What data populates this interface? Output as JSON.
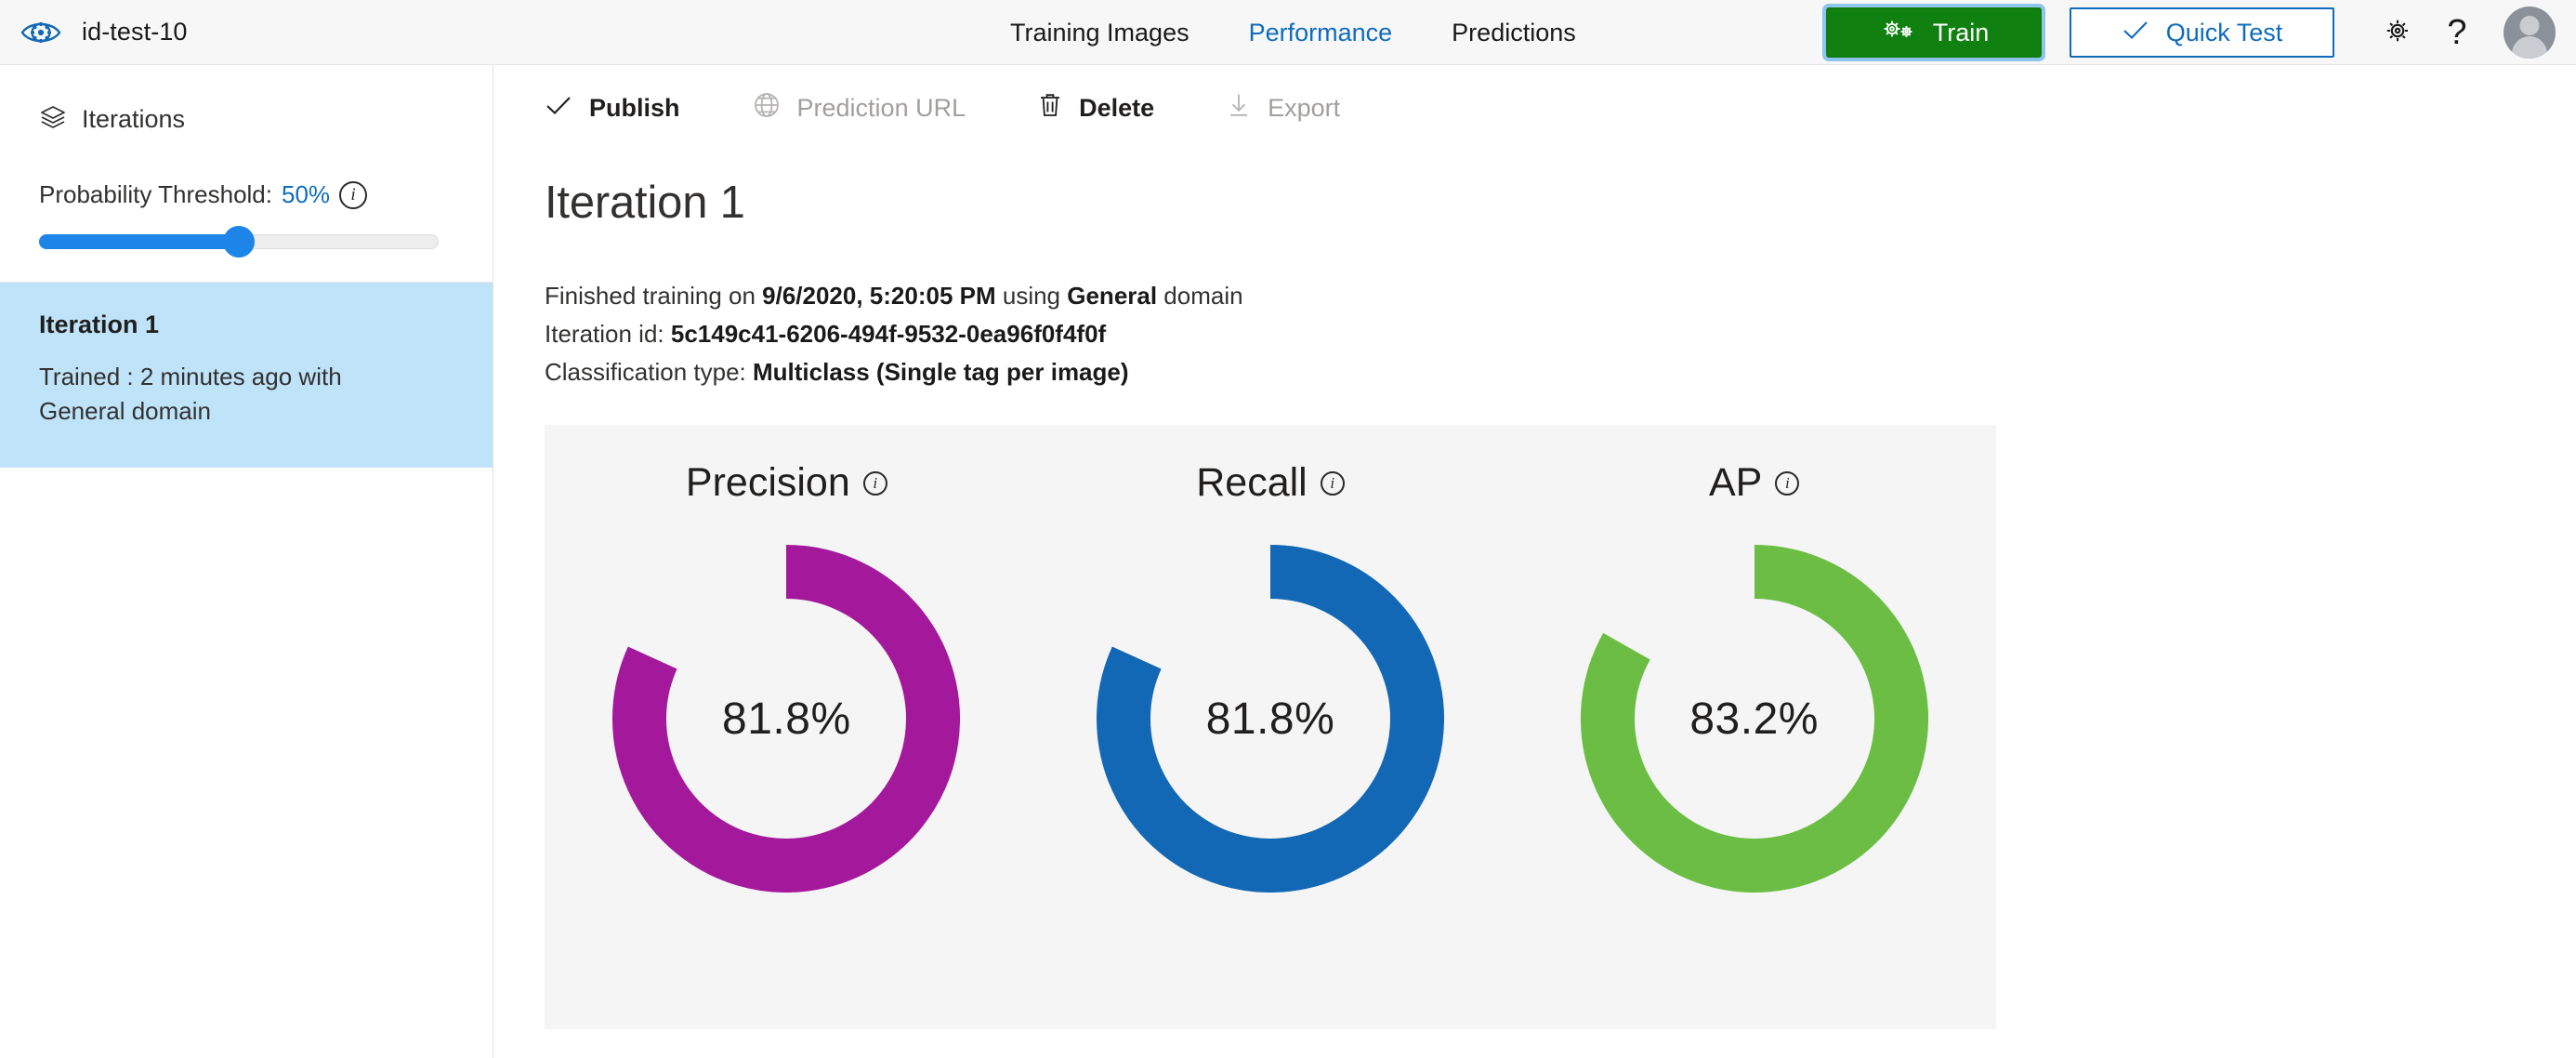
{
  "app": {
    "logo_icon": "eye-gear-logo-icon",
    "project_name": "id-test-10"
  },
  "nav": {
    "tabs": [
      {
        "label": "Training Images",
        "active": false
      },
      {
        "label": "Performance",
        "active": true
      },
      {
        "label": "Predictions",
        "active": false
      }
    ]
  },
  "topbar_actions": {
    "train_label": "Train",
    "train_icon": "gears-icon",
    "train_color": "#108010",
    "quick_test_label": "Quick Test",
    "quick_test_icon": "checkmark-icon",
    "quick_test_color": "#0f6cbd",
    "settings_icon": "gear-icon",
    "help_icon": "question-mark-icon",
    "help_glyph": "?",
    "avatar_icon": "user-avatar-icon"
  },
  "sidebar": {
    "header_label": "Iterations",
    "header_icon": "layers-icon",
    "threshold": {
      "label_prefix": "Probability Threshold:",
      "value": "50%",
      "percent": 50,
      "info_icon": "info-icon",
      "fill_color": "#1e85e8"
    },
    "iterations": [
      {
        "name": "Iteration 1",
        "subtitle": "Trained : 2 minutes ago with General domain",
        "selected": true,
        "selected_color": "#bfe3f9"
      }
    ]
  },
  "toolbar": {
    "items": [
      {
        "label": "Publish",
        "icon": "checkmark-icon",
        "disabled": false
      },
      {
        "label": "Prediction URL",
        "icon": "globe-icon",
        "disabled": true
      },
      {
        "label": "Delete",
        "icon": "trash-icon",
        "disabled": false
      },
      {
        "label": "Export",
        "icon": "download-icon",
        "disabled": true
      }
    ]
  },
  "main": {
    "page_title": "Iteration 1",
    "meta": {
      "line1_pre": "Finished training on ",
      "line1_date": "9/6/2020, 5:20:05 PM",
      "line1_mid": " using ",
      "line1_domain": "General",
      "line1_post": " domain",
      "line2_pre": "Iteration id: ",
      "line2_id": "5c149c41-6206-494f-9532-0ea96f0f4f0f",
      "line3_pre": "Classification type: ",
      "line3_type": "Multiclass (Single tag per image)"
    }
  },
  "chart_data": [
    {
      "type": "pie",
      "title": "Precision",
      "value": 81.8,
      "label": "81.8%",
      "color": "#a4199c",
      "track_color": "#f5f5f5",
      "info_icon": "info-icon",
      "start_angle_deg": 0,
      "sweep_deg": 294.5,
      "max": 100
    },
    {
      "type": "pie",
      "title": "Recall",
      "value": 81.8,
      "label": "81.8%",
      "color": "#1368b5",
      "track_color": "#f5f5f5",
      "info_icon": "info-icon",
      "start_angle_deg": 0,
      "sweep_deg": 294.5,
      "max": 100
    },
    {
      "type": "pie",
      "title": "AP",
      "value": 83.2,
      "label": "83.2%",
      "color": "#6bbe43",
      "track_color": "#f5f5f5",
      "info_icon": "info-icon",
      "start_angle_deg": 0,
      "sweep_deg": 299.5,
      "max": 100
    }
  ]
}
